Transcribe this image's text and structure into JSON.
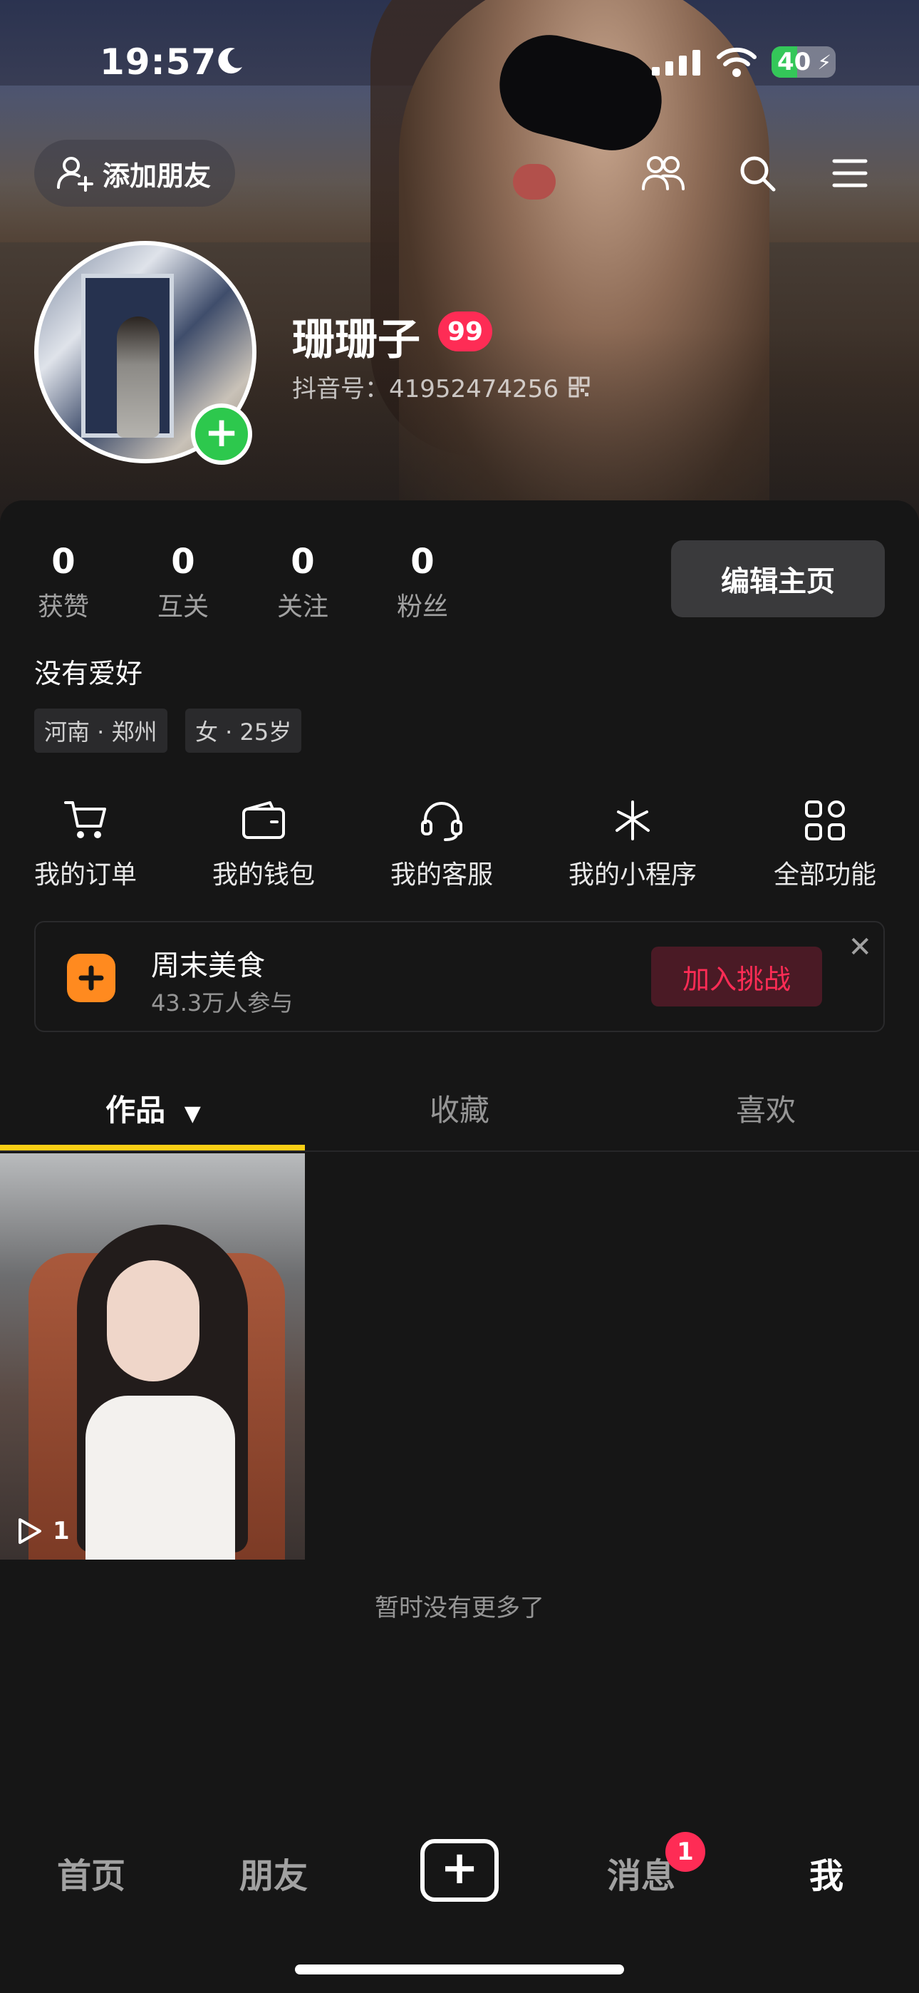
{
  "status_bar": {
    "time": "19:57",
    "battery": "40",
    "battery_level": 0.4
  },
  "header": {
    "add_friend_label": "添加朋友"
  },
  "profile": {
    "name": "珊珊子",
    "level_badge": "99",
    "douyin_id": "抖音号：41952474256",
    "edit_label": "编辑主页",
    "bio": "没有爱好",
    "tags": [
      "河南 · 郑州",
      "女 · 25岁"
    ]
  },
  "stats": [
    {
      "value": "0",
      "label": "获赞"
    },
    {
      "value": "0",
      "label": "互关"
    },
    {
      "value": "0",
      "label": "关注"
    },
    {
      "value": "0",
      "label": "粉丝"
    }
  ],
  "shortcuts": [
    {
      "label": "我的订单",
      "icon": "cart-icon"
    },
    {
      "label": "我的钱包",
      "icon": "wallet-icon"
    },
    {
      "label": "我的客服",
      "icon": "headset-icon"
    },
    {
      "label": "我的小程序",
      "icon": "miniprogram-icon"
    },
    {
      "label": "全部功能",
      "icon": "grid-icon"
    }
  ],
  "challenge": {
    "title": "周末美食",
    "subtitle": "43.3万人参与",
    "join_label": "加入挑战"
  },
  "tabs": [
    {
      "label": "作品"
    },
    {
      "label": "收藏"
    },
    {
      "label": "喜欢"
    }
  ],
  "videos": [
    {
      "plays": "1"
    }
  ],
  "feed_end": "暂时没有更多了",
  "bottom_nav": {
    "home": "首页",
    "friends": "朋友",
    "messages": "消息",
    "messages_badge": "1",
    "me": "我"
  },
  "colors": {
    "accent": "#fe2c55",
    "tab_underline": "#face15",
    "online": "#2dc84d",
    "challenge_icon": "#ff8a1f"
  }
}
